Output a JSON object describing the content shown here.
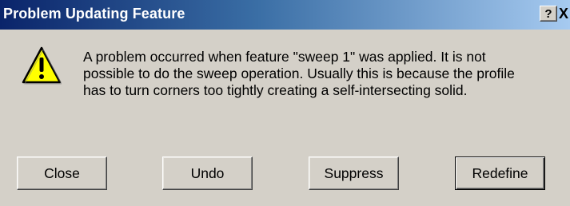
{
  "dialog": {
    "title": "Problem Updating Feature",
    "help_label": "?",
    "close_label": "X",
    "icon": "warning-icon",
    "message_lines": [
      "A problem occurred when feature \"sweep 1\" was applied. It is not",
      "possible to do the sweep operation. Usually this is because the profile",
      "has to turn corners too tightly creating a self-intersecting solid."
    ],
    "buttons": {
      "close": "Close",
      "undo": "Undo",
      "suppress": "Suppress",
      "redefine": "Redefine"
    },
    "colors": {
      "titlebar_start": "#0a246a",
      "titlebar_end": "#a6caf0",
      "face": "#d4d0c8",
      "warning_fill": "#ffff00"
    }
  }
}
